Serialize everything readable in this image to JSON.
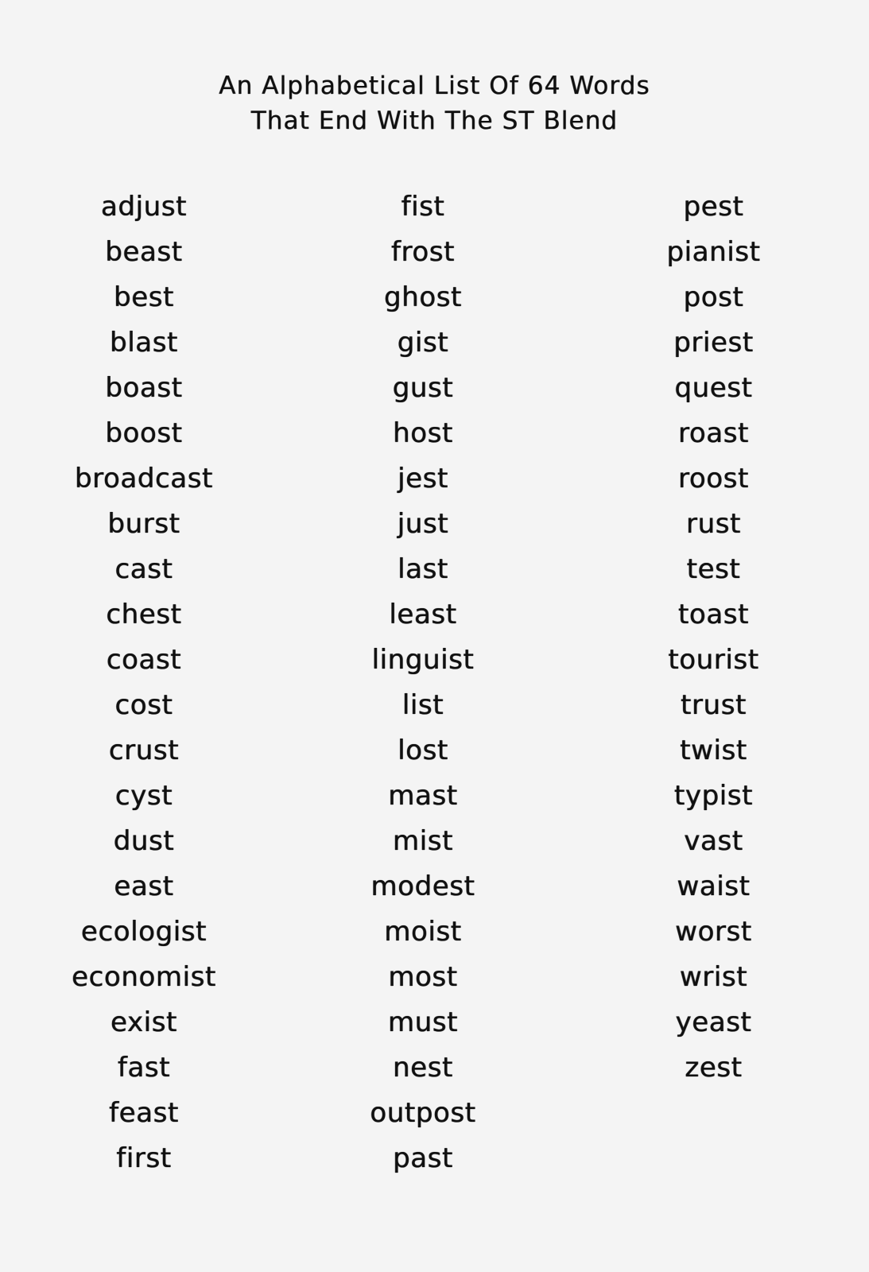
{
  "document": {
    "background_color": "#f4f4f4",
    "text_color": "#101010",
    "title": {
      "line1": "An Alphabetical List Of 64 Words",
      "line2": "That End With The ST Blend"
    },
    "word_count": 64,
    "blend": "ST",
    "columns": [
      {
        "name": "column-1",
        "words": [
          "adjust",
          "beast",
          "best",
          "blast",
          "boast",
          "boost",
          "broadcast",
          "burst",
          "cast",
          "chest",
          "coast",
          "cost",
          "crust",
          "cyst",
          "dust",
          "east",
          "ecologist",
          "economist",
          "exist",
          "fast",
          "feast",
          "first"
        ]
      },
      {
        "name": "column-2",
        "words": [
          "fist",
          "frost",
          "ghost",
          "gist",
          "gust",
          "host",
          "jest",
          "just",
          "last",
          "least",
          "linguist",
          "list",
          "lost",
          "mast",
          "mist",
          "modest",
          "moist",
          "most",
          "must",
          "nest",
          "outpost",
          "past"
        ]
      },
      {
        "name": "column-3",
        "words": [
          "pest",
          "pianist",
          "post",
          "priest",
          "quest",
          "roast",
          "roost",
          "rust",
          "test",
          "toast",
          "tourist",
          "trust",
          "twist",
          "typist",
          "vast",
          "waist",
          "worst",
          "wrist",
          "yeast",
          "zest"
        ]
      }
    ]
  }
}
